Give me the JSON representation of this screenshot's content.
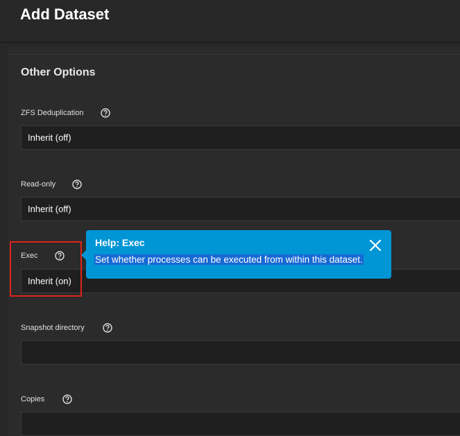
{
  "header": {
    "title": "Add Dataset"
  },
  "section": {
    "title": "Other Options"
  },
  "fields": {
    "dedup": {
      "label": "ZFS Deduplication",
      "value": "Inherit (off)"
    },
    "readonly": {
      "label": "Read-only",
      "value": "Inherit (off)"
    },
    "exec": {
      "label": "Exec",
      "value": "Inherit (on)"
    },
    "snapdir": {
      "label": "Snapshot directory",
      "value": ""
    },
    "copies": {
      "label": "Copies",
      "value": ""
    }
  },
  "tooltip": {
    "title": "Help: Exec",
    "text": "Set whether processes can be executed from within this dataset."
  },
  "colors": {
    "tooltip_bg": "#0095d5",
    "text_selection": "#1769d4",
    "highlight": "#e0231b"
  }
}
